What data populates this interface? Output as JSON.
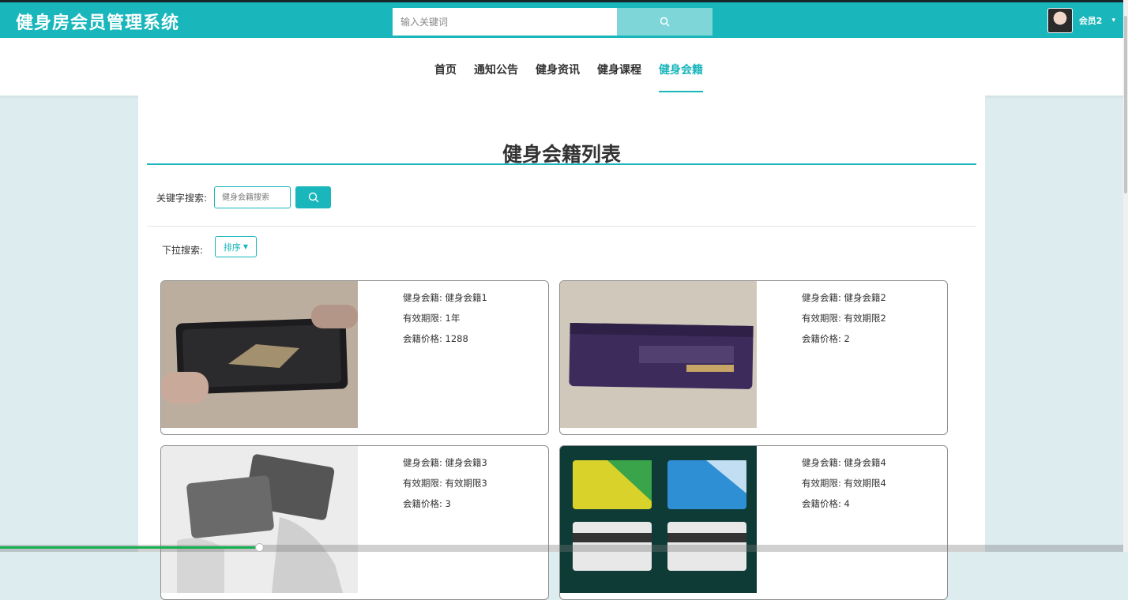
{
  "header": {
    "brand": "健身房会员管理系统",
    "search_placeholder": "输入关键词",
    "user_name": "会员2"
  },
  "nav": {
    "items": [
      {
        "label": "首页"
      },
      {
        "label": "通知公告"
      },
      {
        "label": "健身资讯"
      },
      {
        "label": "健身课程"
      },
      {
        "label": "健身会籍",
        "active": true
      }
    ]
  },
  "page": {
    "title": "健身会籍列表",
    "keyword_label": "关键字搜索:",
    "keyword_placeholder": "健身会籍搜索",
    "dropdown_label": "下拉搜索:",
    "sort_button": "排序"
  },
  "cards": [
    {
      "name_label": "健身会籍:",
      "name": "健身会籍1",
      "period_label": "有效期限:",
      "period": "1年",
      "price_label": "会籍价格:",
      "price": "1288"
    },
    {
      "name_label": "健身会籍:",
      "name": "健身会籍2",
      "period_label": "有效期限:",
      "period": "有效期限2",
      "price_label": "会籍价格:",
      "price": "2"
    },
    {
      "name_label": "健身会籍:",
      "name": "健身会籍3",
      "period_label": "有效期限:",
      "period": "有效期限3",
      "price_label": "会籍价格:",
      "price": "3"
    },
    {
      "name_label": "健身会籍:",
      "name": "健身会籍4",
      "period_label": "有效期限:",
      "period": "有效期限4",
      "price_label": "会籍价格:",
      "price": "4"
    }
  ],
  "colors": {
    "accent": "#19b6bb",
    "search_button": "#7fd6d9",
    "progress": "#15b050"
  },
  "icons": {
    "search": "search-icon",
    "caret": "caret-down-icon"
  },
  "bottom_progress": 0.23
}
